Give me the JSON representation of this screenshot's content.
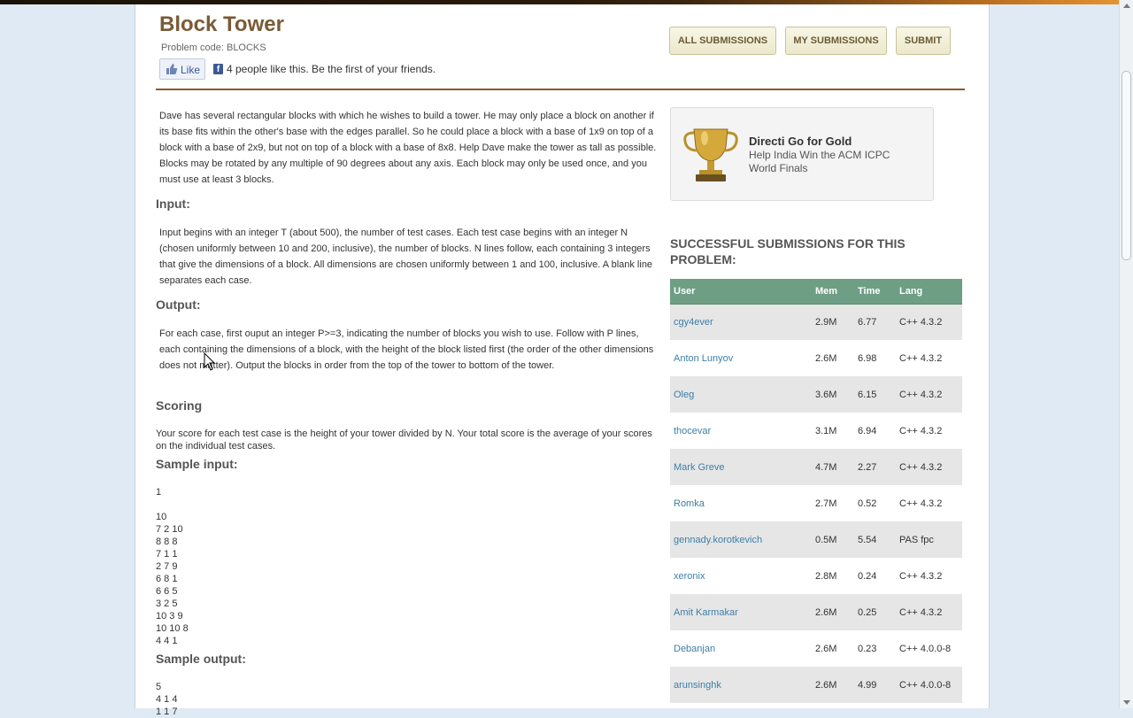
{
  "problem": {
    "title": "Block Tower",
    "code_label": "Problem code: BLOCKS"
  },
  "social": {
    "like_label": "Like",
    "like_text": "4 people like this. Be the first of your friends."
  },
  "header_buttons": {
    "all": "ALL SUBMISSIONS",
    "mine": "MY SUBMISSIONS",
    "submit": "SUBMIT"
  },
  "statement": {
    "intro": "Dave has several rectangular blocks with which he wishes to build a tower. He may only place a block on another if its base fits within the other's base with the edges parallel. So he could place a block with a base of 1x9 on top of a block with a base of 2x9, but not on top of a block with a base of 8x8. Help Dave make the tower as tall as possible. Blocks may be rotated by any multiple of 90 degrees about any axis. Each block may only be used once, and you must use at least 3 blocks.",
    "input_heading": "Input:",
    "input_text": "Input begins with an integer T (about 500), the number of test cases. Each test case begins with an integer N (chosen uniformly between 10 and 200, inclusive), the number of blocks. N lines follow, each containing 3 integers that give the dimensions of a block. All dimensions are chosen uniformly between 1 and 100, inclusive. A blank line separates each case.",
    "output_heading": "Output:",
    "output_text": "For each case, first ouput an integer P>=3, indicating the number of blocks you wish to use. Follow with P lines, each containing the dimensions of a block, with the height of the block listed first (the order of the other dimensions does not matter). Output the blocks in order from the top of the tower to bottom of the tower.",
    "scoring_heading": "Scoring",
    "scoring_text": "Your score for each test case is the height of your tower divided by N. Your total score is the average of your scores on the individual test cases.",
    "sample_input_heading": "Sample input:",
    "sample_input": "1\n\n10\n7 2 10\n8 8 8\n7 1 1\n2 7 9\n6 8 1\n6 6 5\n3 2 5\n10 3 9\n10 10 8\n4 4 1",
    "sample_output_heading": "Sample output:",
    "sample_output": "5\n4 1 4\n1 1 7"
  },
  "promo": {
    "title": "Directi Go for Gold",
    "line1": "Help India Win the ACM ICPC",
    "line2": "World Finals"
  },
  "submissions": {
    "heading": "SUCCESSFUL SUBMISSIONS FOR THIS PROBLEM:",
    "columns": [
      "User",
      "Mem",
      "Time",
      "Lang"
    ],
    "rows": [
      {
        "user": "cgy4ever",
        "mem": "2.9M",
        "time": "6.77",
        "lang": "C++ 4.3.2"
      },
      {
        "user": "Anton Lunyov",
        "mem": "2.6M",
        "time": "6.98",
        "lang": "C++ 4.3.2"
      },
      {
        "user": "Oleg",
        "mem": "3.6M",
        "time": "6.15",
        "lang": "C++ 4.3.2"
      },
      {
        "user": "thocevar",
        "mem": "3.1M",
        "time": "6.94",
        "lang": "C++ 4.3.2"
      },
      {
        "user": "Mark Greve",
        "mem": "4.7M",
        "time": "2.27",
        "lang": "C++ 4.3.2"
      },
      {
        "user": "Romka",
        "mem": "2.7M",
        "time": "0.52",
        "lang": "C++ 4.3.2"
      },
      {
        "user": "gennady.korotkevich",
        "mem": "0.5M",
        "time": "5.54",
        "lang": "PAS fpc"
      },
      {
        "user": "xeronix",
        "mem": "2.8M",
        "time": "0.24",
        "lang": "C++ 4.3.2"
      },
      {
        "user": "Amit Karmakar",
        "mem": "2.6M",
        "time": "0.25",
        "lang": "C++ 4.3.2"
      },
      {
        "user": "Debanjan",
        "mem": "2.6M",
        "time": "0.23",
        "lang": "C++ 4.0.0-8"
      },
      {
        "user": "arunsinghk",
        "mem": "2.6M",
        "time": "4.99",
        "lang": "C++ 4.0.0-8"
      }
    ]
  },
  "colors": {
    "title_brown": "#7a5a36",
    "table_header_green": "#6e9e84",
    "link_blue": "#3d7fa8"
  }
}
